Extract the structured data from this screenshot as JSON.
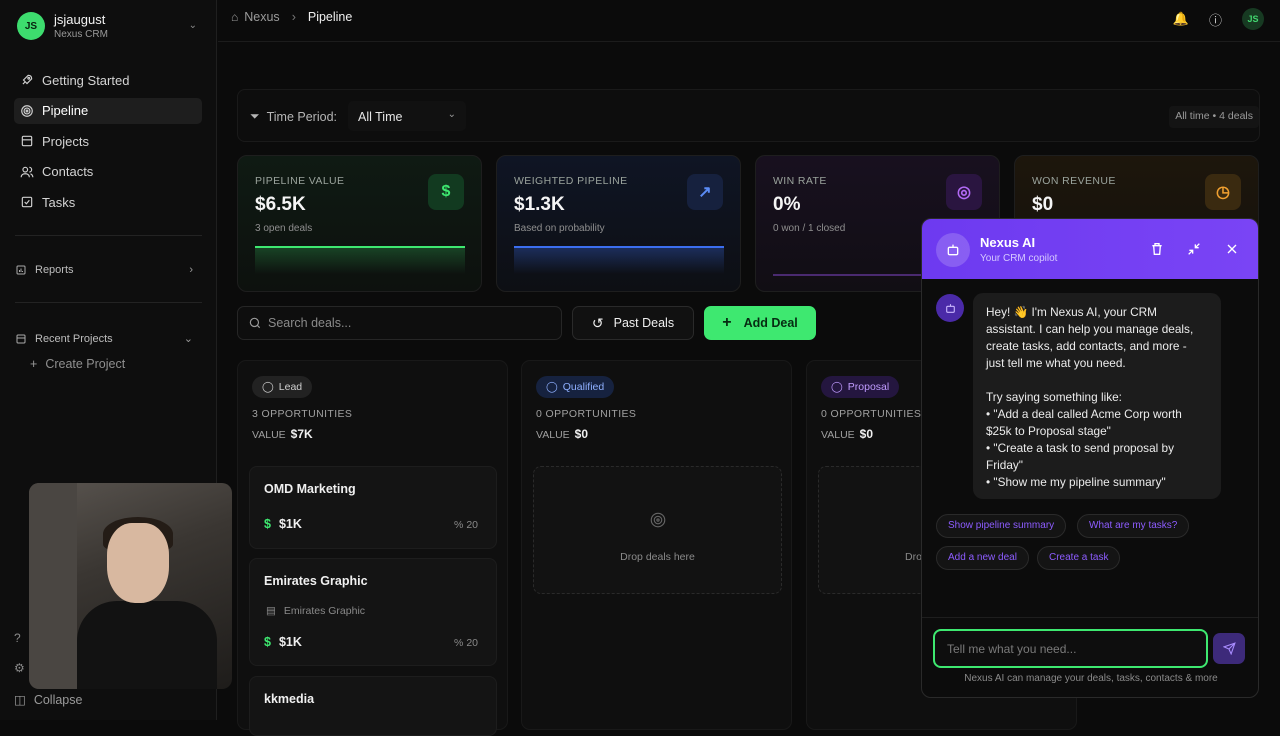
{
  "account": {
    "initials": "JS",
    "name": "jsjaugust",
    "org": "Nexus CRM"
  },
  "nav": [
    {
      "label": "Getting Started",
      "icon": "rocket-icon"
    },
    {
      "label": "Pipeline",
      "icon": "target-icon",
      "active": true
    },
    {
      "label": "Projects",
      "icon": "folder-icon"
    },
    {
      "label": "Contacts",
      "icon": "users-icon"
    },
    {
      "label": "Tasks",
      "icon": "checkbox-icon"
    }
  ],
  "reports": {
    "label": "Reports"
  },
  "recent_projects": {
    "label": "Recent Projects",
    "create_label": "Create Project"
  },
  "collapse_label": "Collapse",
  "breadcrumb": {
    "home": "Nexus",
    "current": "Pipeline"
  },
  "user_initials": "JS",
  "filter": {
    "label": "Time Period:",
    "value": "All Time",
    "summary": "All time • 4 deals"
  },
  "stats": [
    {
      "label": "PIPELINE VALUE",
      "value": "$6.5K",
      "sub": "3 open deals",
      "icon": "dollar-icon",
      "color": "#3ee870"
    },
    {
      "label": "WEIGHTED PIPELINE",
      "value": "$1.3K",
      "sub": "Based on probability",
      "icon": "trend-up-icon",
      "color": "#3b6ef0"
    },
    {
      "label": "WIN RATE",
      "value": "0%",
      "sub": "0 won / 1 closed",
      "icon": "target-icon",
      "color": "#a04ff0"
    },
    {
      "label": "WON REVENUE",
      "value": "$0",
      "sub": "",
      "icon": "clock-icon",
      "color": "#f0a030"
    }
  ],
  "search": {
    "placeholder": "Search deals..."
  },
  "buttons": {
    "past_deals": "Past Deals",
    "add_deal": "Add Deal"
  },
  "columns": [
    {
      "tag": "Lead",
      "opportunities": "3 OPPORTUNITIES",
      "value_label": "VALUE",
      "value": "$7K",
      "color": "#9a9a9a",
      "cards": [
        {
          "name": "OMD Marketing",
          "amount": "$1K",
          "pct": "20",
          "org": ""
        },
        {
          "name": "Emirates Graphic",
          "amount": "$1K",
          "pct": "20",
          "org": "Emirates Graphic"
        },
        {
          "name": "kkmedia",
          "amount": "",
          "pct": "",
          "org": ""
        }
      ]
    },
    {
      "tag": "Qualified",
      "opportunities": "0 OPPORTUNITIES",
      "value_label": "VALUE",
      "value": "$0",
      "color": "#5b8cf5",
      "drop_text": "Drop deals here"
    },
    {
      "tag": "Proposal",
      "opportunities": "0 OPPORTUNITIES",
      "value_label": "VALUE",
      "value": "$0",
      "color": "#a56cf5",
      "drop_text": "Drop"
    }
  ],
  "chat": {
    "title": "Nexus AI",
    "subtitle": "Your CRM copilot",
    "message": "Hey! 👋 I'm Nexus AI, your CRM\nassistant. I can help you manage deals,\ncreate tasks, add contacts, and more -\njust tell me what you need.\n\nTry saying something like:\n• \"Add a deal called Acme Corp worth\n$25k to Proposal stage\"\n• \"Create a task to send proposal by\nFriday\"\n• \"Show me my pipeline summary\"",
    "suggestions": [
      "Show pipeline summary",
      "What are my tasks?",
      "Add a new deal",
      "Create a task"
    ],
    "input_placeholder": "Tell me what you need...",
    "footer": "Nexus AI can manage your deals, tasks, contacts & more"
  }
}
